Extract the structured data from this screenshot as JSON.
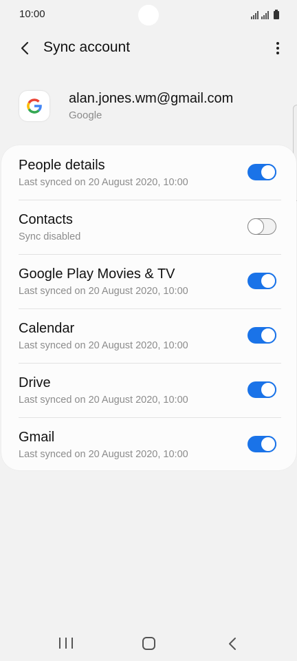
{
  "status_bar": {
    "time": "10:00"
  },
  "app_bar": {
    "title": "Sync account"
  },
  "account": {
    "email": "alan.jones.wm@gmail.com",
    "type": "Google"
  },
  "sync_items": [
    {
      "title": "People details",
      "subtitle": "Last synced on 20 August 2020, 10:00",
      "enabled": true
    },
    {
      "title": "Contacts",
      "subtitle": "Sync disabled",
      "enabled": false
    },
    {
      "title": "Google Play Movies & TV",
      "subtitle": "Last synced on 20 August 2020, 10:00",
      "enabled": true
    },
    {
      "title": "Calendar",
      "subtitle": "Last synced on 20 August 2020, 10:00",
      "enabled": true
    },
    {
      "title": "Drive",
      "subtitle": "Last synced on 20 August 2020, 10:00",
      "enabled": true
    },
    {
      "title": "Gmail",
      "subtitle": "Last synced on 20 August 2020, 10:00",
      "enabled": true
    }
  ],
  "colors": {
    "accent": "#1a73e8",
    "background": "#f2f2f2",
    "card": "#fcfcfc"
  },
  "icons": {
    "back": "arrow-left-icon",
    "more": "more-vert-icon",
    "logo": "google-logo-icon",
    "nav_recents": "recents-icon",
    "nav_home": "home-icon",
    "nav_back": "back-icon"
  }
}
